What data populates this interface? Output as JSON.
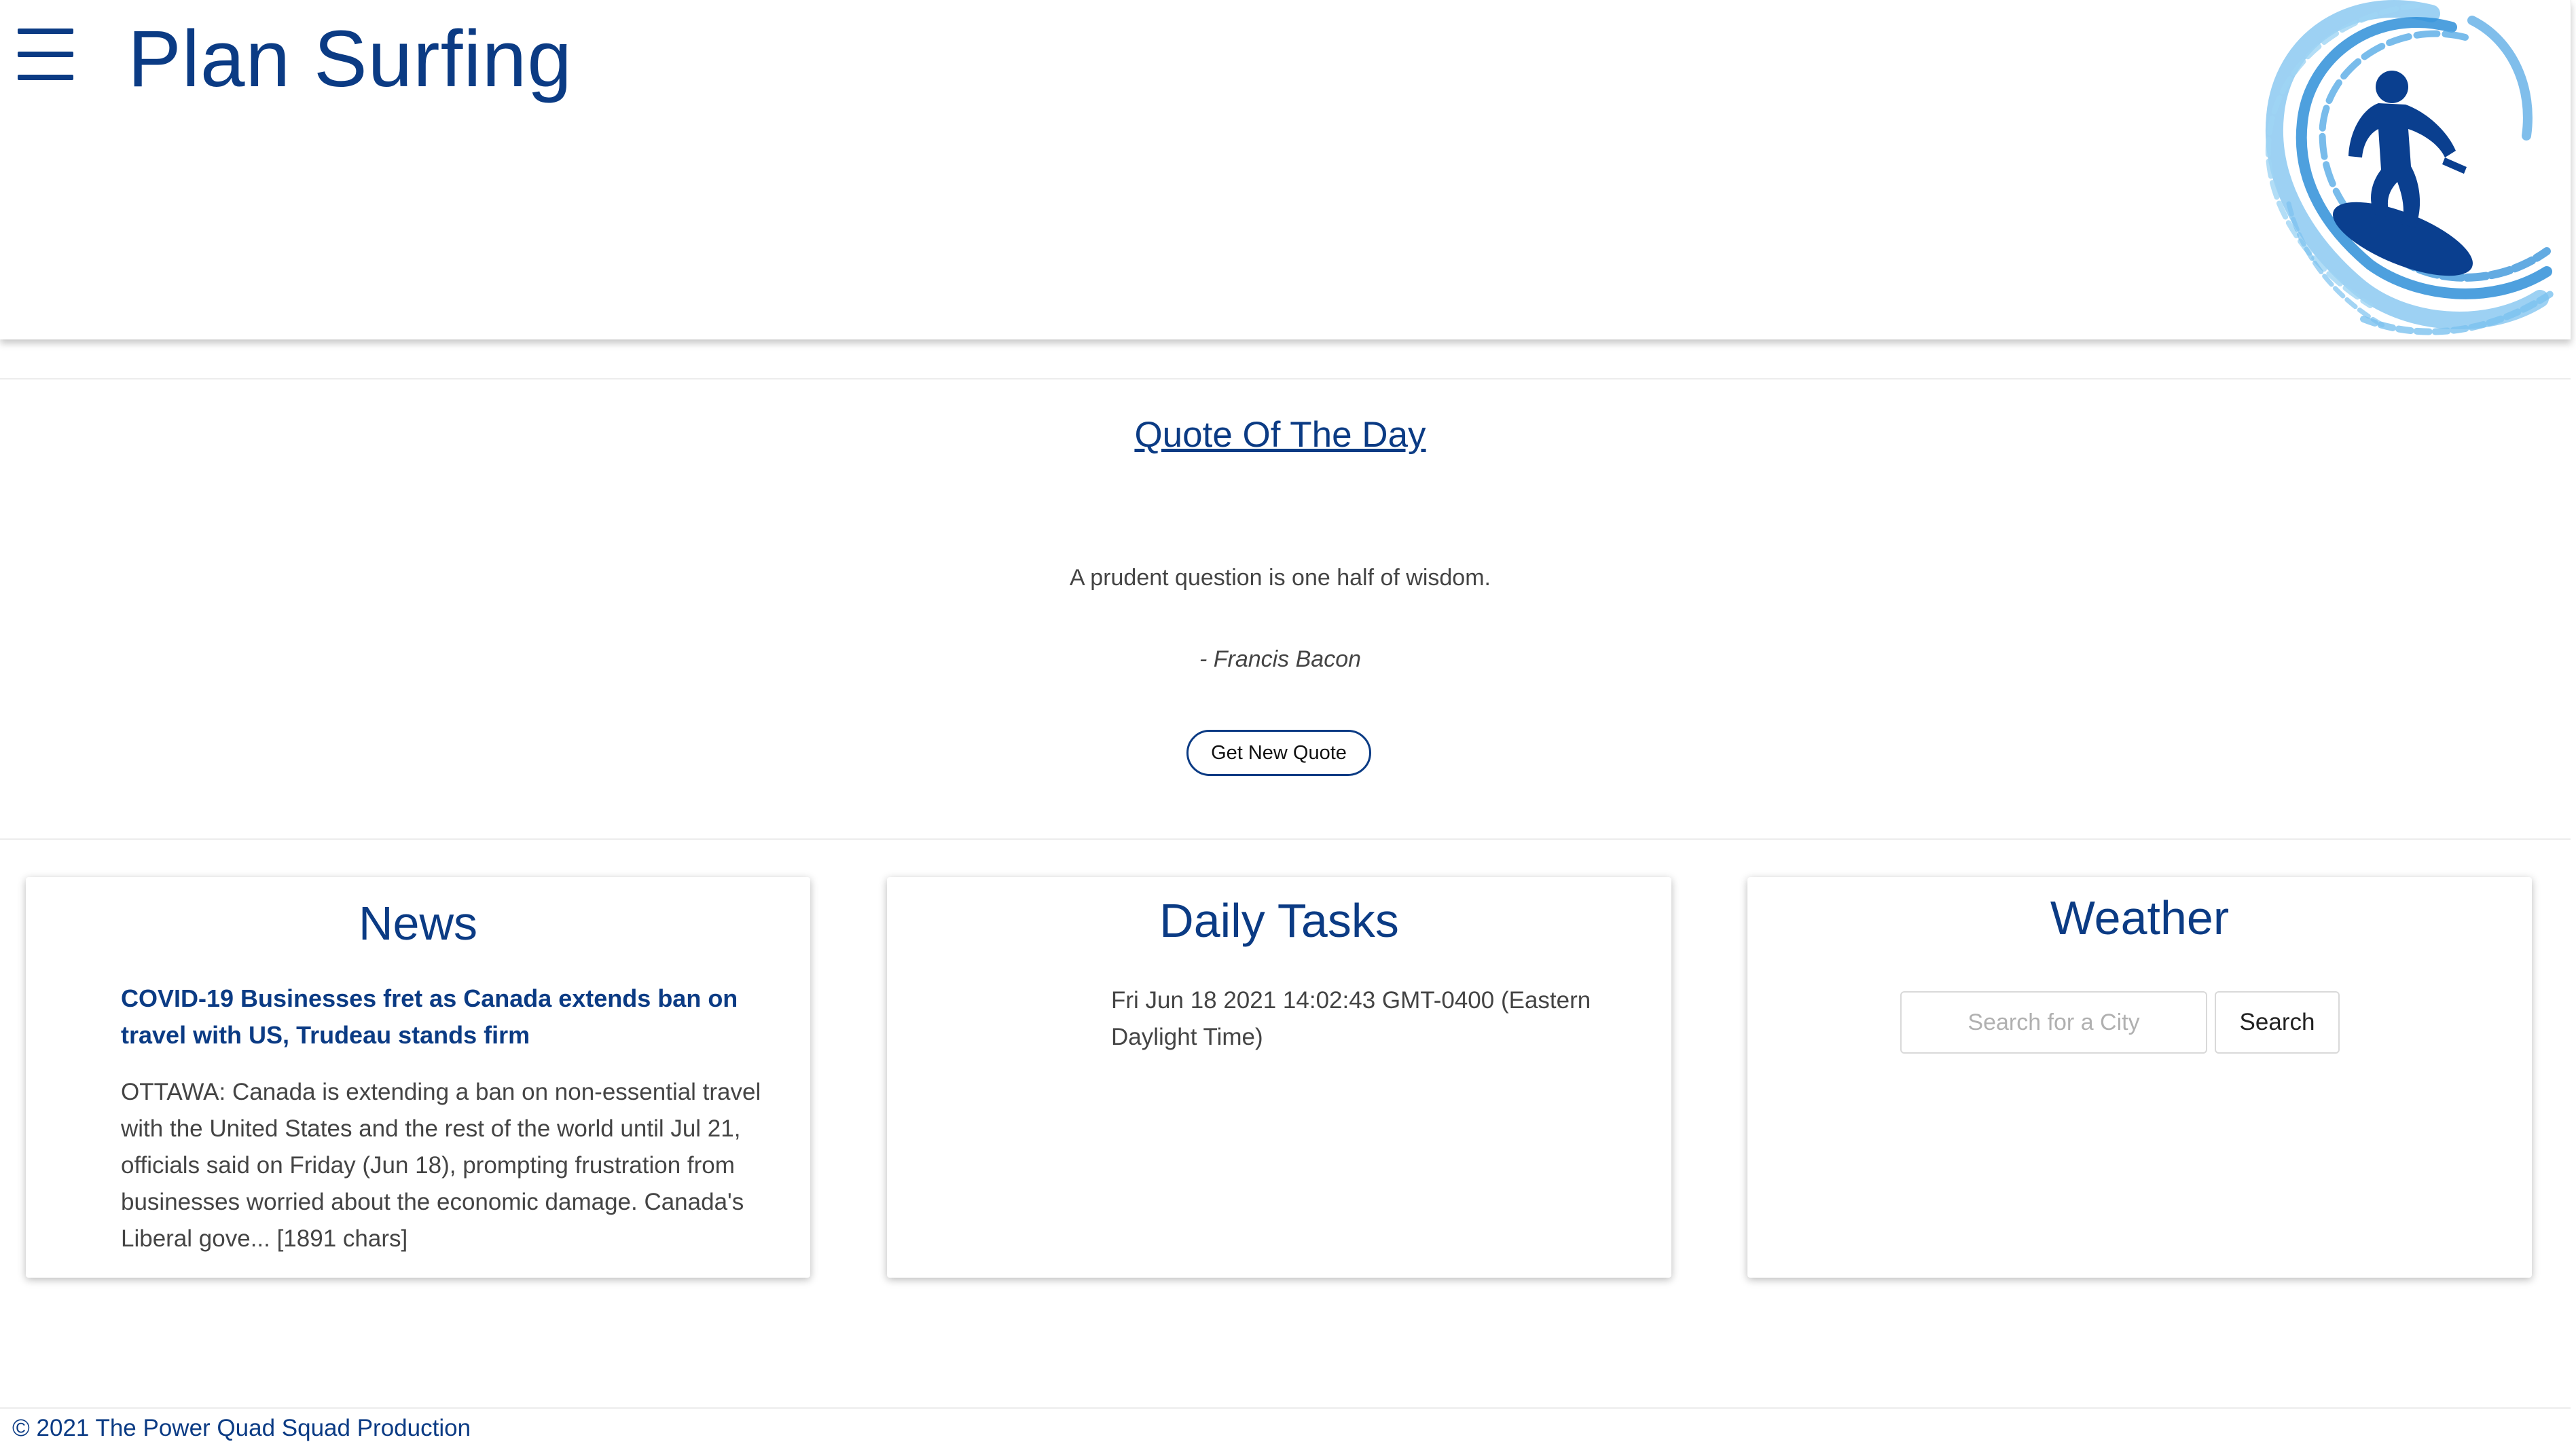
{
  "header": {
    "title": "Plan Surfing",
    "menu_icon": "hamburger-menu-icon",
    "logo_icon": "surfer-wave-icon"
  },
  "quote": {
    "heading": "Quote Of The Day",
    "text": "A prudent question is one half of wisdom.",
    "author": "- Francis Bacon",
    "button_label": "Get New Quote"
  },
  "news": {
    "title": "News",
    "headline": "COVID-19 Businesses fret as Canada extends ban on travel with US, Trudeau stands firm",
    "body": "OTTAWA: Canada is extending a ban on non-essential travel with the United States and the rest of the world until Jul 21, officials said on Friday (Jun 18), prompting frustration from businesses worried about the economic damage. Canada's Liberal gove... [1891 chars]"
  },
  "tasks": {
    "title": "Daily Tasks",
    "datetime": "Fri Jun 18 2021 14:02:43 GMT-0400 (Eastern Daylight Time)"
  },
  "weather": {
    "title": "Weather",
    "search_placeholder": "Search for a City",
    "search_value": "",
    "search_button_label": "Search"
  },
  "footer": {
    "text": "© 2021 The Power Quad Squad Production"
  },
  "colors": {
    "brand": "#0b3b84",
    "wave_light": "#7cc2ef",
    "wave_mid": "#2f8fd8",
    "surfer": "#0a3f8f"
  }
}
